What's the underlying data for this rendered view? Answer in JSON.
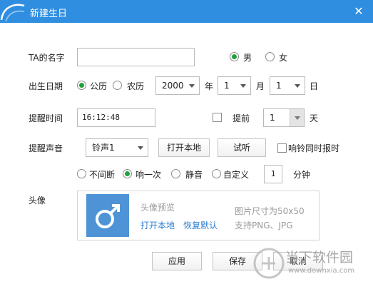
{
  "window": {
    "title": "新建生日"
  },
  "form": {
    "name_label": "TA的名字",
    "name_value": "",
    "gender_male": "男",
    "gender_female": "女",
    "birth_label": "出生日期",
    "calendar_solar": "公历",
    "calendar_lunar": "农历",
    "year_value": "2000",
    "year_unit": "年",
    "month_value": "1",
    "month_unit": "月",
    "day_value": "1",
    "day_unit": "日",
    "remind_time_label": "提醒时间",
    "remind_time_value": "16:12:48",
    "advance_label": "提前",
    "advance_days_value": "1",
    "advance_unit": "天",
    "sound_label": "提醒声音",
    "sound_value": "铃声1",
    "open_local": "打开本地",
    "try_listen": "试听",
    "sync_clock": "响铃同时报时",
    "mode_continuous": "不间断",
    "mode_once": "响一次",
    "mode_mute": "静音",
    "mode_custom": "自定义",
    "custom_minutes_value": "1",
    "minutes_unit": "分钟",
    "avatar_label": "头像"
  },
  "avatar": {
    "preview_label": "头像预览",
    "open_local": "打开本地",
    "restore_default": "恢复默认",
    "size_hint": "图片尺寸为50x50",
    "format_hint": "支持PNG、JPG"
  },
  "footer": {
    "apply": "应用",
    "save": "保存",
    "cancel": "取消"
  },
  "watermark": {
    "brand": "当下软件园",
    "url": "www.downxia.com"
  },
  "colors": {
    "titlebar": "#2f8ee0",
    "radio_selected": "#20a23a",
    "link": "#2f7fd0",
    "avatar_bg": "#4e93d6"
  }
}
